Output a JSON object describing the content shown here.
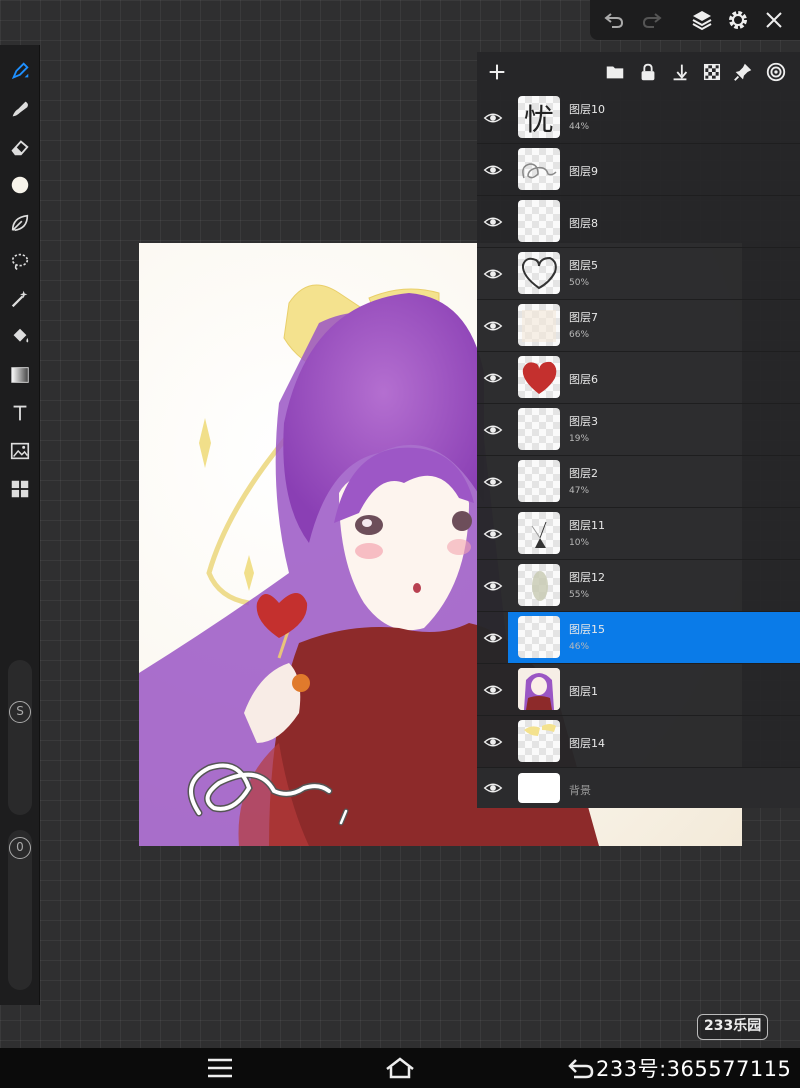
{
  "app": {
    "accent_color": "#0a7be8",
    "icons": {
      "brush": "brush-icon",
      "smudge": "smudge-icon",
      "eraser": "eraser-icon",
      "color": "color-dot-icon",
      "lasso": "leaf-icon",
      "selection": "lasso-select-icon",
      "magic_wand": "magic-wand-icon",
      "fill": "paint-bucket-icon",
      "gradient": "gradient-icon",
      "text": "text-icon",
      "image": "image-icon",
      "grid": "panel-grid-icon"
    }
  },
  "toolbar": {
    "size_slider_label": "S",
    "opacity_slider_label": "0"
  },
  "top_controls": [
    "undo-icon",
    "redo-icon",
    "layers-icon",
    "gear-icon",
    "close-icon"
  ],
  "layers_header": [
    "add-icon",
    "folder-icon",
    "lock-icon",
    "merge-down-icon",
    "checker-icon",
    "pin-icon",
    "target-icon"
  ],
  "layers": [
    {
      "name": "图层10",
      "opacity": "44%"
    },
    {
      "name": "图层9",
      "opacity": ""
    },
    {
      "name": "图层8",
      "opacity": ""
    },
    {
      "name": "图层5",
      "opacity": "50%"
    },
    {
      "name": "图层7",
      "opacity": "66%"
    },
    {
      "name": "图层6",
      "opacity": ""
    },
    {
      "name": "图层3",
      "opacity": "19%"
    },
    {
      "name": "图层2",
      "opacity": "47%"
    },
    {
      "name": "图层11",
      "opacity": "10%"
    },
    {
      "name": "图层12",
      "opacity": "55%"
    },
    {
      "name": "图层15",
      "opacity": "46%",
      "selected": true
    },
    {
      "name": "图层1",
      "opacity": ""
    },
    {
      "name": "图层14",
      "opacity": ""
    }
  ],
  "background_layer": {
    "name": "背景"
  },
  "thumb_text": {
    "layer10": "忧"
  },
  "watermark": "233乐园",
  "navbar": {
    "account_text": "233号:365577115"
  }
}
